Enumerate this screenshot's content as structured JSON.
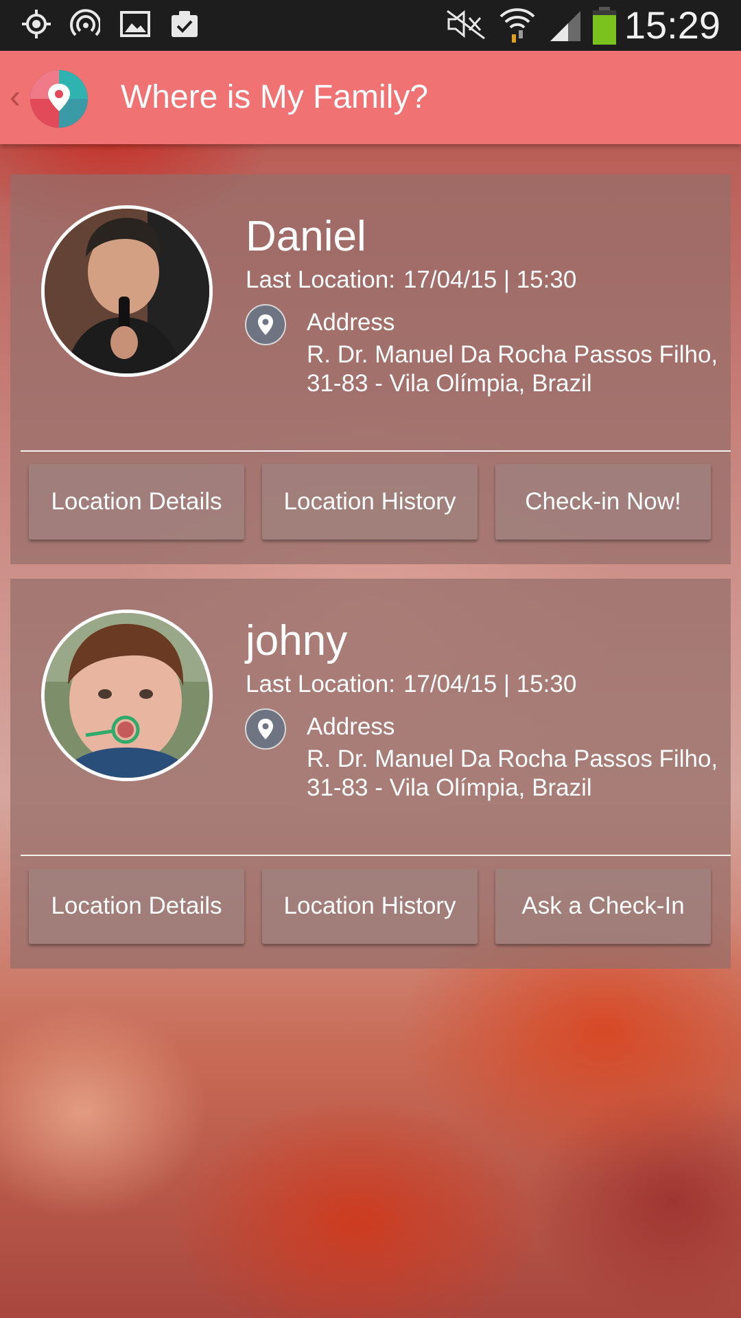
{
  "status_bar": {
    "time": "15:29",
    "icons": [
      "location-target-icon",
      "wifi-hotspot-icon",
      "gallery-icon",
      "clipboard-check-icon",
      "mute-icon",
      "wifi-icon",
      "signal-icon",
      "battery-icon"
    ]
  },
  "app_bar": {
    "title": "Where is My Family?",
    "logo_icon": "location-pin-logo-icon"
  },
  "members": [
    {
      "name": "Daniel",
      "last_location_label": "Last Location:",
      "last_location_value": "17/04/15 | 15:30",
      "address_label": "Address",
      "address_line1": "R. Dr. Manuel Da Rocha Passos Filho,",
      "address_line2": "31-83 - Vila Olímpia, Brazil",
      "buttons": [
        "Location Details",
        "Location History",
        "Check-in Now!"
      ]
    },
    {
      "name": "johny",
      "last_location_label": "Last Location:",
      "last_location_value": "17/04/15 | 15:30",
      "address_label": "Address",
      "address_line1": "R. Dr. Manuel Da Rocha Passos Filho,",
      "address_line2": "31-83 - Vila Olímpia, Brazil",
      "buttons": [
        "Location Details",
        "Location History",
        "Ask a Check-In"
      ]
    }
  ],
  "colors": {
    "app_bar": "#f07272",
    "status_bar": "#1d1d1d",
    "card": "#966e69",
    "pin": "#6f7482"
  }
}
